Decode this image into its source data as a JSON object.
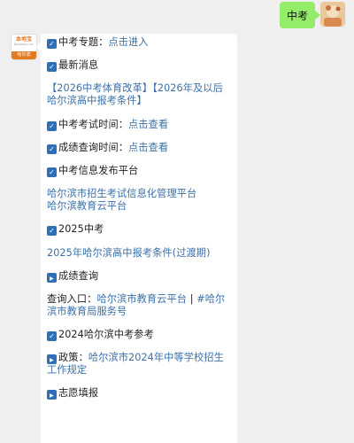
{
  "outgoing": {
    "message": "中考"
  },
  "sender": {
    "brand": "本地宝",
    "site": "Bendibao.com",
    "city": "哈尔滨"
  },
  "message": {
    "topic_prefix": "中考专题：",
    "topic_link": "点击进入",
    "latest_news": "最新消息",
    "news_links": "【2026中考体育改革】【2026年及以后哈尔滨高中报考条件】",
    "exam_time_prefix": "中考考试时间：",
    "exam_time_link": "点击查看",
    "score_query_prefix": "成绩查询时间：",
    "score_query_link": "点击查看",
    "info_platform": "中考信息发布平台",
    "platform_links": [
      "哈尔滨市招生考试信息化管理平台",
      "哈尔滨教育云平台"
    ],
    "zhongkao_2025": "2025中考",
    "conditions_2025": "2025年哈尔滨高中报考条件(过渡期)",
    "score_query": "成绩查询",
    "query_entry_prefix": "查询入口：",
    "query_entry_link_1": "哈尔滨市教育云平台",
    "query_entry_separator": " | ",
    "query_entry_link_2": "#哈尔滨市教育局服务号",
    "reference_2024": "2024哈尔滨中考参考",
    "policy_prefix": "政策：",
    "policy_link": "哈尔滨市2024年中等学校招生工作规定",
    "volunteer": "志愿填报"
  },
  "colors": {
    "page_bg": "#efefef",
    "outgoing_bubble": "#95ec69",
    "link": "#3a6fa8",
    "icon": "#2f6fb6",
    "brand_orange": "#e07b22"
  },
  "icons": {
    "check": "check-box-icon",
    "play": "play-box-icon"
  }
}
